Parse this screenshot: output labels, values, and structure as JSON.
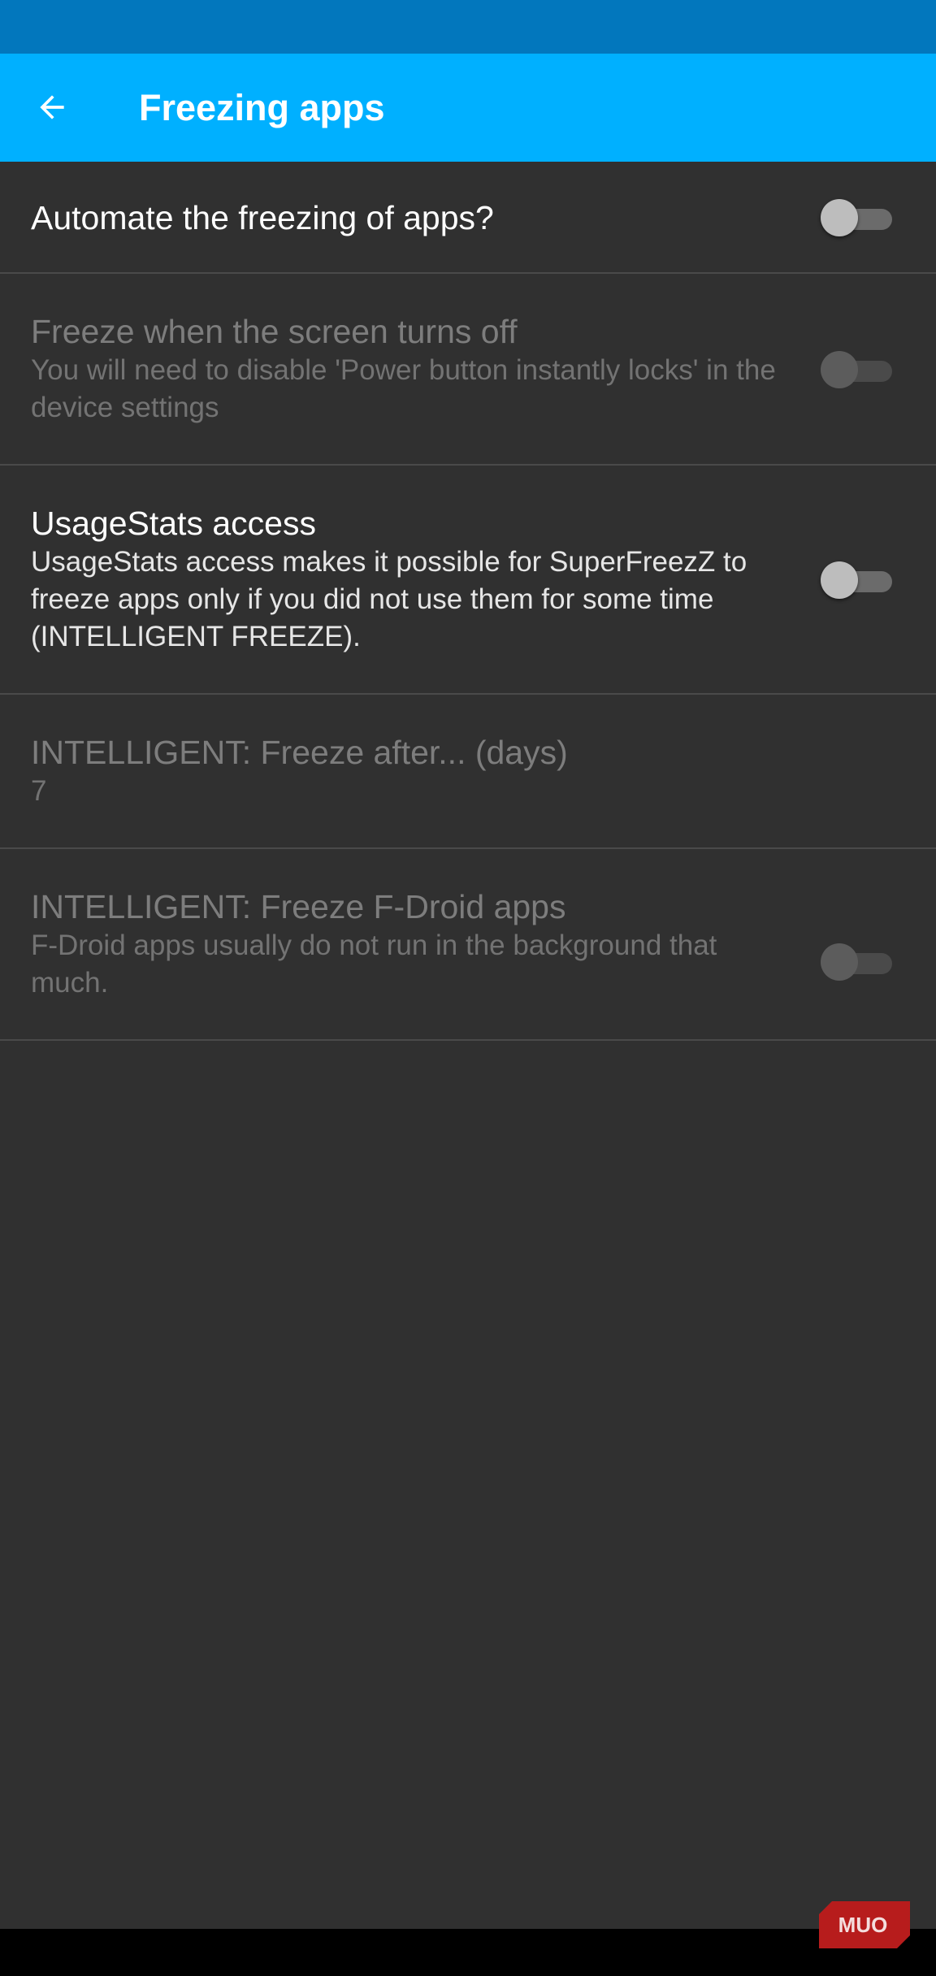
{
  "app_bar": {
    "title": "Freezing apps",
    "back_icon": "arrow-back-icon",
    "background_color": "#00b0ff",
    "status_bar_color": "#0277bd"
  },
  "preferences": [
    {
      "title": "Automate the freezing of apps?",
      "summary": "",
      "enabled": true,
      "switch_on": false
    },
    {
      "title": "Freeze when the screen turns off",
      "summary": "You will need to disable 'Power button instantly locks' in the device settings",
      "enabled": false,
      "switch_on": false
    },
    {
      "title": "UsageStats access",
      "summary": "UsageStats access makes it possible for SuperFreezZ to freeze apps only if you did not use them for some time (INTELLIGENT FREEZE).",
      "enabled": true,
      "switch_on": false
    },
    {
      "title": "INTELLIGENT: Freeze after... (days)",
      "summary": "7",
      "enabled": false
    },
    {
      "title": "INTELLIGENT: Freeze F-Droid apps",
      "summary": "F-Droid apps usually do not run in the background that much.",
      "enabled": false,
      "switch_on": false
    }
  ],
  "watermark": {
    "text": "MUO",
    "color": "#c62828"
  }
}
